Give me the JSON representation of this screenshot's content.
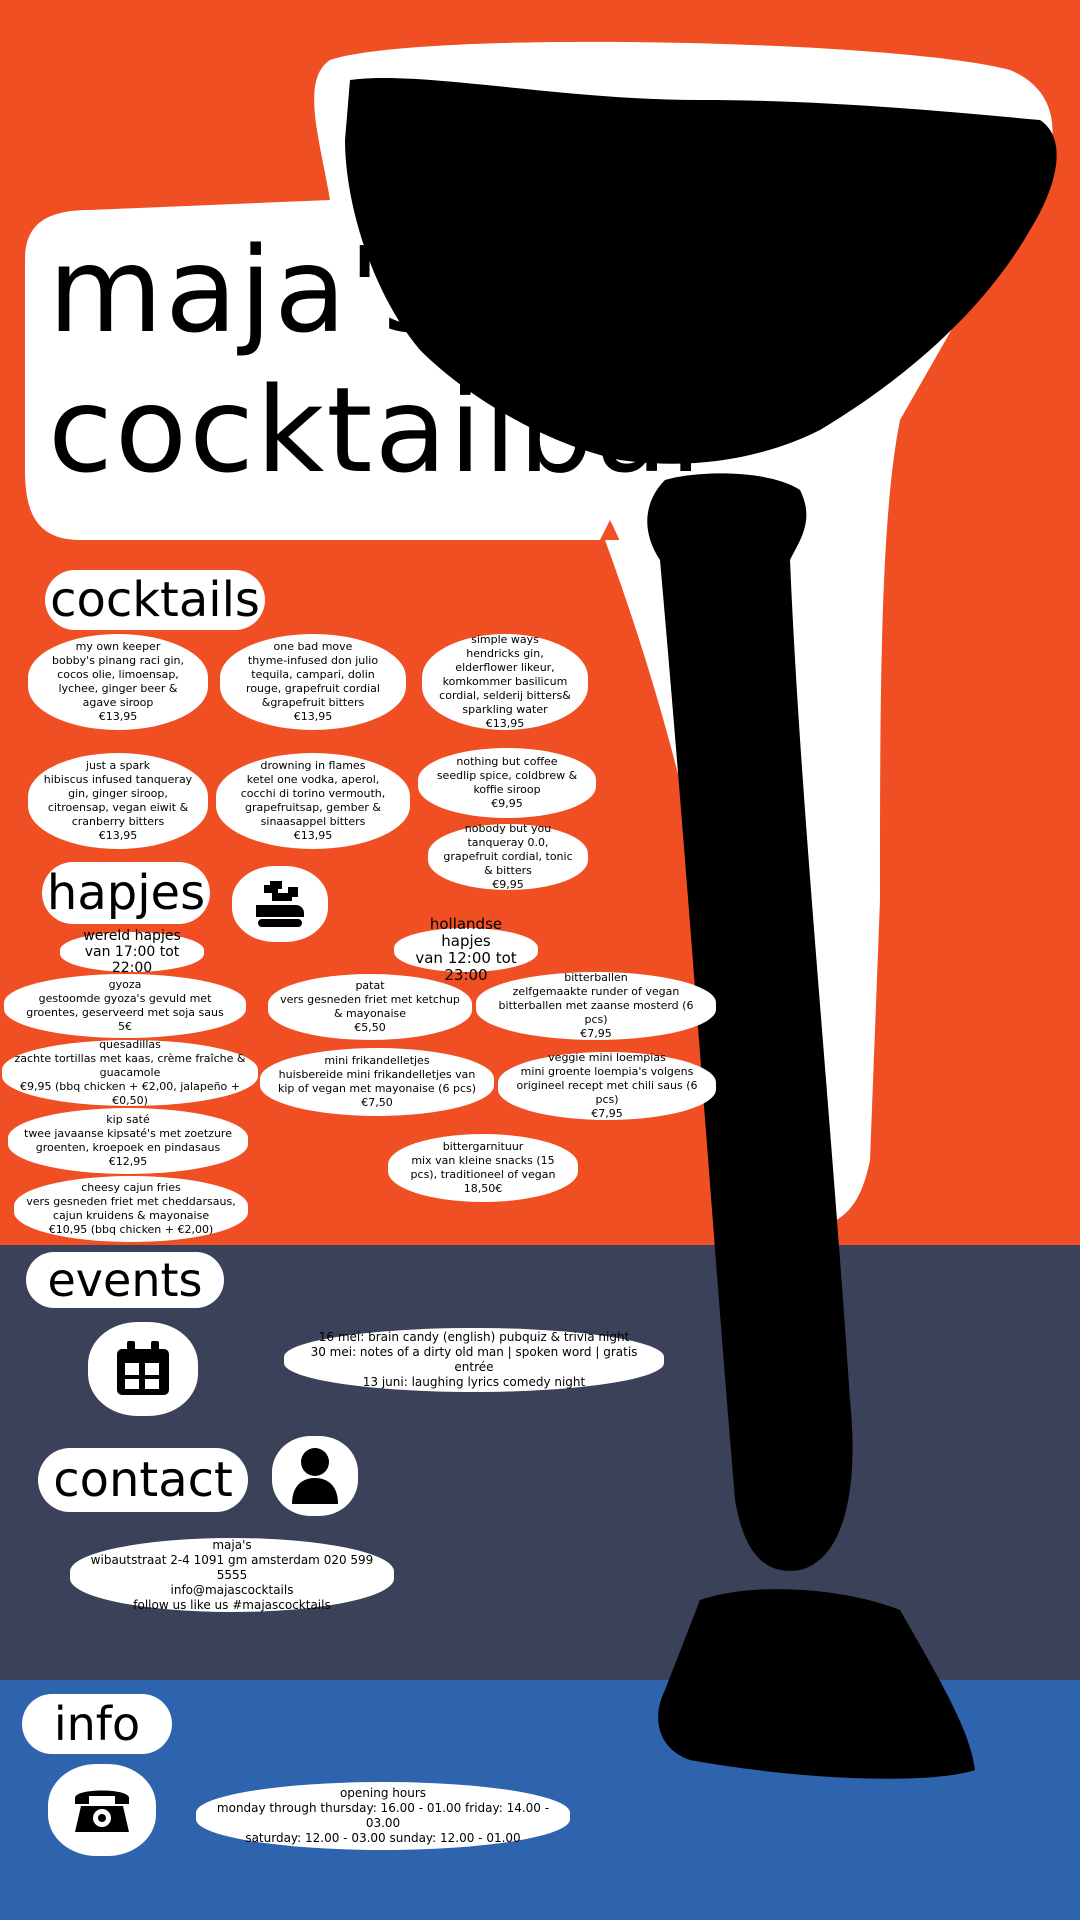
{
  "brand": {
    "line1": "maja's",
    "line2": "cocktailbar"
  },
  "colors": {
    "top": "#F04E23",
    "middle": "#3A4158",
    "bottom": "#2E64AD"
  },
  "cocktails": {
    "heading": "cocktails",
    "items": [
      {
        "name": "my own keeper",
        "desc": "bobby's pinang raci gin, cocos olie, limoensap, lychee, ginger beer & agave siroop",
        "price": "€13,95"
      },
      {
        "name": "one bad move",
        "desc": "thyme-infused don julio tequila, campari, dolin rouge, grapefruit cordial &grapefruit bitters",
        "price": "€13,95"
      },
      {
        "name": "simple ways",
        "desc": "hendricks gin, elderflower likeur, komkommer basilicum cordial, selderij bitters& sparkling water",
        "price": "€13,95"
      },
      {
        "name": "just a spark",
        "desc": "hibiscus infused tanqueray gin, ginger siroop, citroensap, vegan eiwit & cranberry bitters",
        "price": "€13,95"
      },
      {
        "name": "drowning in flames",
        "desc": "ketel one vodka, aperol, cocchi di torino vermouth, grapefruitsap, gember & sinaasappel bitters",
        "price": "€13,95"
      },
      {
        "name": "nothing but coffee",
        "desc": "seedlip spice, coldbrew & koffie siroop",
        "price": "€9,95"
      },
      {
        "name": "nobody but you",
        "desc": "tanqueray 0.0, grapefruit cordial, tonic & bitters",
        "price": "€9,95"
      }
    ]
  },
  "hapjes": {
    "heading": "hapjes",
    "icon": "food-icon",
    "wereld": {
      "title": "wereld hapjes",
      "hours": "van 17:00 tot 22:00",
      "items": [
        {
          "name": "gyoza",
          "desc": "gestoomde gyoza's gevuld met groentes, geserveerd met soja saus",
          "price": "5€"
        },
        {
          "name": "quesadillas",
          "desc": "zachte tortillas met kaas, crème fraîche & guacamole",
          "price": "€9,95 (bbq chicken + €2,00, jalapeño + €0,50)"
        },
        {
          "name": "kip saté",
          "desc": "twee javaanse kipsaté's met zoetzure groenten, kroepoek en pindasaus",
          "price": "€12,95"
        },
        {
          "name": "cheesy cajun fries",
          "desc": "vers gesneden friet met cheddarsaus, cajun kruidens & mayonaise",
          "price": "€10,95 (bbq chicken + €2,00)"
        }
      ]
    },
    "hollandse": {
      "title": "hollandse hapjes",
      "hours": "van 12:00 tot 23:00",
      "items": [
        {
          "name": "patat",
          "desc": "vers gesneden friet met ketchup & mayonaise",
          "price": "€5,50"
        },
        {
          "name": "bitterballen",
          "desc": "zelfgemaakte runder of vegan bitterballen met zaanse mosterd (6 pcs)",
          "price": "€7,95"
        },
        {
          "name": "mini frikandelletjes",
          "desc": "huisbereide mini frikandelletjes van kip of vegan met mayonaise (6 pcs)",
          "price": "€7,50"
        },
        {
          "name": "veggie mini loempias",
          "desc": "mini groente loempia's volgens origineel recept met chili saus (6 pcs)",
          "price": "€7,95"
        },
        {
          "name": "bittergarnituur",
          "desc": "mix van kleine snacks (15 pcs), traditioneel of vegan",
          "price": "18,50€"
        }
      ]
    }
  },
  "events": {
    "heading": "events",
    "icon": "calendar-icon",
    "lines": [
      "16 mei: brain candy (english) pubquiz & trivia night",
      "30 mei: notes of a dirty old man | spoken word | gratis entrée",
      "13 juni: laughing lyrics comedy night"
    ]
  },
  "contact": {
    "heading": "contact",
    "icon": "person-icon",
    "lines": [
      "maja's",
      "wibautstraat 2-4 1091 gm amsterdam 020 599 5555",
      "info@majascocktails",
      "follow us like us #majascocktails"
    ]
  },
  "info": {
    "heading": "info",
    "icon": "telephone-icon",
    "lines": [
      "opening hours",
      "monday through thursday: 16.00 - 01.00 friday: 14.00 - 03.00",
      "saturday: 12.00 - 03.00 sunday: 12.00 - 01.00"
    ]
  }
}
